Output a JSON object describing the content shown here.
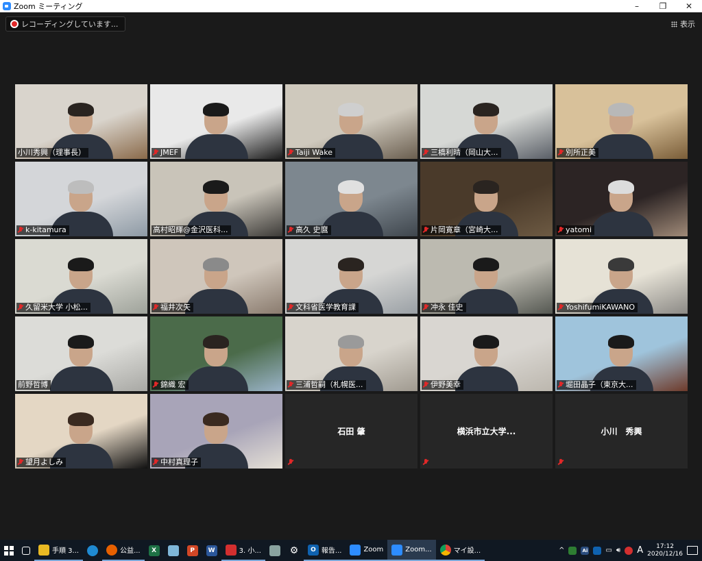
{
  "window": {
    "title": "Zoom ミーティング",
    "minimize": "–",
    "maximize": "❐",
    "close": "✕"
  },
  "recording": {
    "label": "レコーディングしています..."
  },
  "view_button": {
    "label": "表示"
  },
  "participants": [
    {
      "name": "小川秀興（理事長）",
      "muted": false,
      "video": true
    },
    {
      "name": "JMEF",
      "muted": true,
      "video": true
    },
    {
      "name": "Taiji Wake",
      "muted": true,
      "video": true
    },
    {
      "name": "三橋利晴（岡山大...",
      "muted": true,
      "video": true
    },
    {
      "name": "別所正美",
      "muted": true,
      "video": true
    },
    {
      "name": "k-kitamura",
      "muted": true,
      "video": true
    },
    {
      "name": "高村昭輝@金沢医科...",
      "muted": false,
      "video": true
    },
    {
      "name": "高久 史麿",
      "muted": true,
      "video": true
    },
    {
      "name": "片岡寛章（宮崎大...",
      "muted": true,
      "video": true
    },
    {
      "name": "yatomi",
      "muted": true,
      "video": true
    },
    {
      "name": "久留米大学 小松...",
      "muted": true,
      "video": true
    },
    {
      "name": "福井次矢",
      "muted": true,
      "video": true
    },
    {
      "name": "文科省医学教育課",
      "muted": true,
      "video": true
    },
    {
      "name": "冲永 佳史",
      "muted": true,
      "video": true
    },
    {
      "name": "YoshifumiKAWANO",
      "muted": true,
      "video": true
    },
    {
      "name": "前野哲博",
      "muted": false,
      "video": true,
      "active": true
    },
    {
      "name": "錦織 宏",
      "muted": true,
      "video": true
    },
    {
      "name": "三浦哲嗣（札幌医...",
      "muted": true,
      "video": true
    },
    {
      "name": "伊野美幸",
      "muted": true,
      "video": true
    },
    {
      "name": "堀田晶子（東京大...",
      "muted": true,
      "video": true
    },
    {
      "name": "望月よしみ",
      "muted": true,
      "video": true
    },
    {
      "name": "中村真理子",
      "muted": true,
      "video": true
    },
    {
      "name": "石田 肇",
      "muted": true,
      "video": false
    },
    {
      "name": "横浜市立大学...",
      "muted": true,
      "video": false
    },
    {
      "name": "小川　秀興",
      "muted": true,
      "video": false
    }
  ],
  "taskbar": {
    "items": [
      {
        "label": "手順 3...",
        "icon": "folder-icon",
        "color": "#e8b923"
      },
      {
        "label": "公益...",
        "icon": "firefox-icon",
        "color": "#e66000"
      },
      {
        "label": "報告...",
        "icon": "outlook-icon",
        "color": "#0f62b0"
      },
      {
        "label": "Zoom",
        "icon": "zoom-icon",
        "color": "#2d8cff"
      },
      {
        "label": "Zoom...",
        "icon": "zoom-icon",
        "color": "#2d8cff"
      },
      {
        "label": "マイ設...",
        "icon": "chrome-icon",
        "color": "#3c9b45"
      },
      {
        "label": "3. 小...",
        "icon": "pdf-icon",
        "color": "#d32f2f"
      }
    ],
    "time": "17:12",
    "date": "2020/12/16",
    "ime": "A"
  },
  "colors": {
    "active_speaker": "#c7e034",
    "muted": "#e02828",
    "taskbar": "#101822"
  }
}
